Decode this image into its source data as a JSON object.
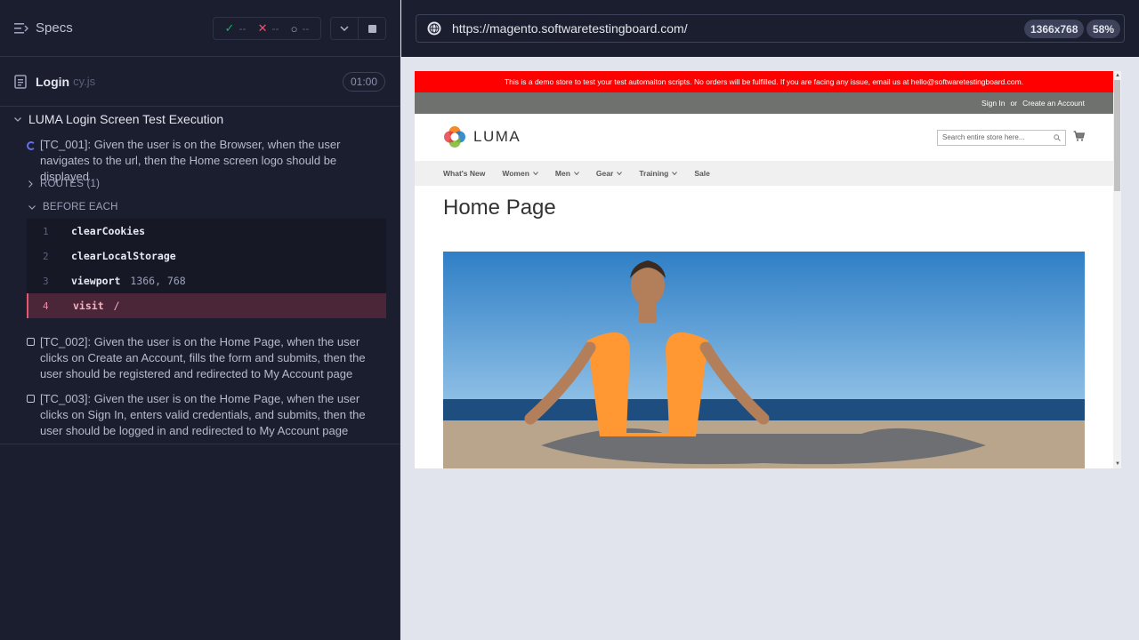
{
  "reporter": {
    "specs_label": "Specs",
    "stats": {
      "passed": "--",
      "failed": "--",
      "pending": "--"
    },
    "spec": {
      "name": "Login",
      "ext": "cy.js",
      "duration": "01:00"
    },
    "suite_title": "LUMA Login Screen Test Execution",
    "tests": [
      {
        "title": "[TC_001]: Given the user is on the Browser, when the user navigates to the url, then the Home screen logo should be displayed",
        "state": "running"
      },
      {
        "title": "[TC_002]: Given the user is on the Home Page, when the user clicks on Create an Account, fills the form and submits, then the user should be registered and redirected to My Account page",
        "state": "pending"
      },
      {
        "title": "[TC_003]: Given the user is on the Home Page, when the user clicks on Sign In, enters valid credentials, and submits, then the user should be logged in and redirected to My Account page",
        "state": "pending"
      }
    ],
    "routes_label": "ROUTES (1)",
    "before_each_label": "BEFORE EACH",
    "commands": [
      {
        "num": "1",
        "name": "clearCookies",
        "message": ""
      },
      {
        "num": "2",
        "name": "clearLocalStorage",
        "message": ""
      },
      {
        "num": "3",
        "name": "viewport",
        "message": "1366, 768"
      },
      {
        "num": "4",
        "name": "visit",
        "message": "/"
      }
    ]
  },
  "runner": {
    "url": "https://magento.softwaretestingboard.com/",
    "viewport": "1366x768",
    "scale": "58%"
  },
  "aut": {
    "promo_message": "This is a demo store to test your test automaiton scripts. No orders will be fulfilled. If you are facing any issue, email us at hello@softwaretestingboard.com.",
    "sign_in": "Sign In",
    "or": "or",
    "create_account": "Create an Account",
    "logo_text": "LUMA",
    "search_placeholder": "Search entire store here...",
    "nav": [
      "What's New",
      "Women",
      "Men",
      "Gear",
      "Training",
      "Sale"
    ],
    "page_title": "Home Page"
  },
  "colors": {
    "reporter_bg": "#1b1e2e",
    "runner_bg": "#e1e3ed",
    "pass": "#1fa971",
    "fail": "#e45770",
    "running": "#6470f3",
    "promo": "#ff0000",
    "luma_orange": "#f5831f"
  }
}
